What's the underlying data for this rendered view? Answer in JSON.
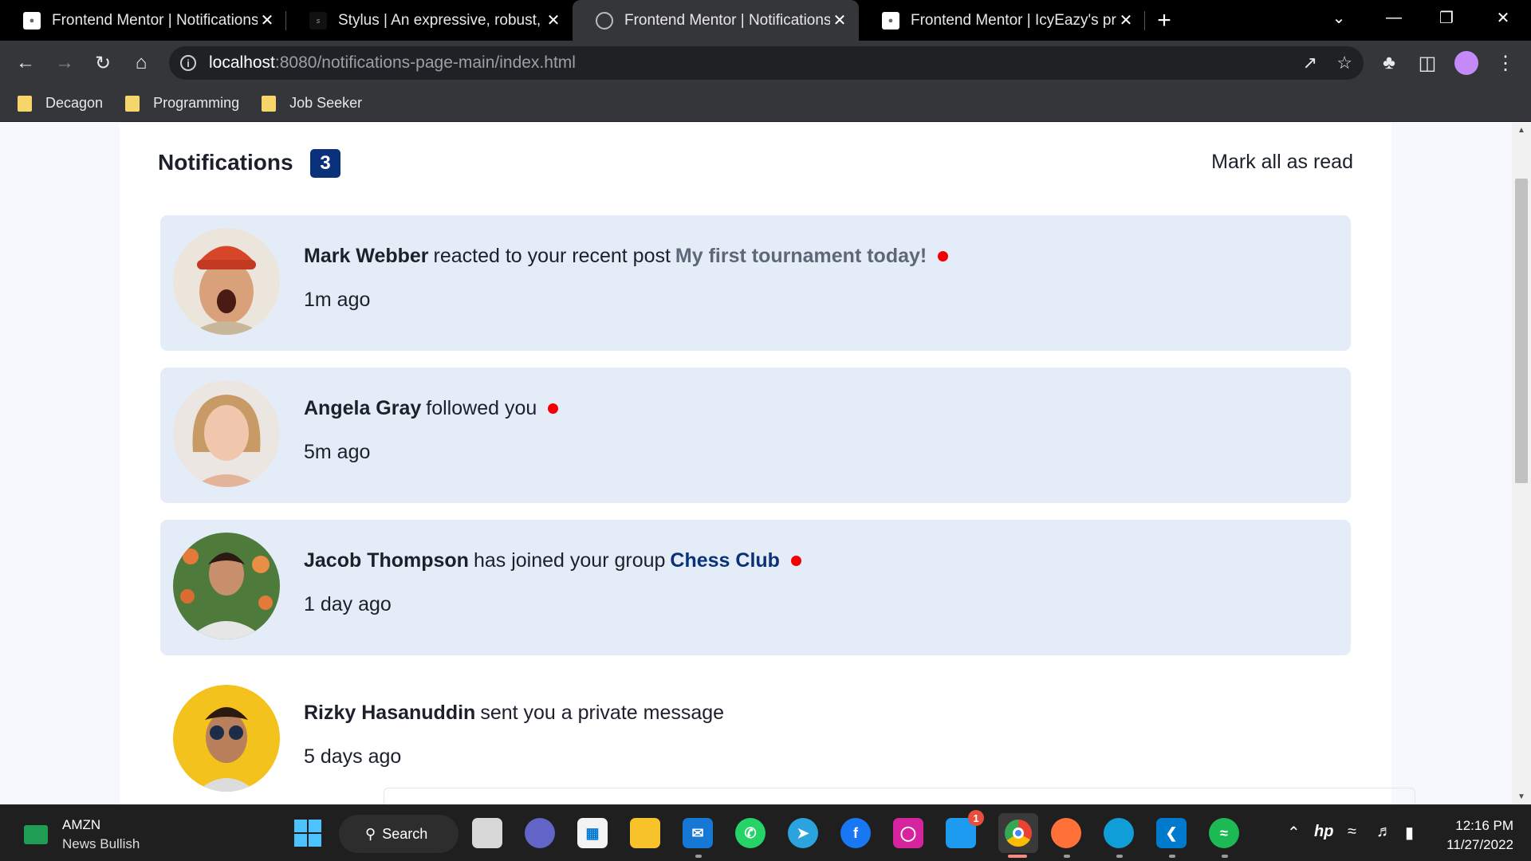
{
  "browser": {
    "tabs": [
      {
        "title": "Frontend Mentor | Notifications page",
        "active": false
      },
      {
        "title": "Stylus | An expressive, robust, feature-rich CSS language",
        "active": false
      },
      {
        "title": "Frontend Mentor | Notifications page",
        "active": true
      },
      {
        "title": "Frontend Mentor | IcyEazy's profile",
        "active": false
      }
    ],
    "url_host": "localhost",
    "url_path": ":8080/notifications-page-main/index.html",
    "bookmarks": [
      "Decagon",
      "Programming",
      "Job Seeker"
    ]
  },
  "page": {
    "title": "Notifications",
    "unread_count": "3",
    "mark_all_label": "Mark all as read",
    "notifications": [
      {
        "name": "Mark Webber",
        "text": "reacted to your recent post",
        "post": "My first tournament today!",
        "group": "",
        "time": "1m ago",
        "unread": true
      },
      {
        "name": "Angela Gray",
        "text": "followed you",
        "post": "",
        "group": "",
        "time": "5m ago",
        "unread": true
      },
      {
        "name": "Jacob Thompson",
        "text": "has joined your group",
        "post": "",
        "group": "Chess Club",
        "time": "1 day ago",
        "unread": true
      },
      {
        "name": "Rizky Hasanuddin",
        "text": "sent you a private message",
        "post": "",
        "group": "",
        "time": "5 days ago",
        "unread": false
      }
    ]
  },
  "taskbar": {
    "stock_symbol": "AMZN",
    "stock_news": "News Bullish",
    "search_label": "Search",
    "twitter_badge": "1",
    "time": "12:16 PM",
    "date": "11/27/2022"
  },
  "colors": {
    "unread_bg": "#e4edf7",
    "badge": "#0a327b",
    "dot": "#f40000",
    "accent_text": "#5e6778"
  }
}
